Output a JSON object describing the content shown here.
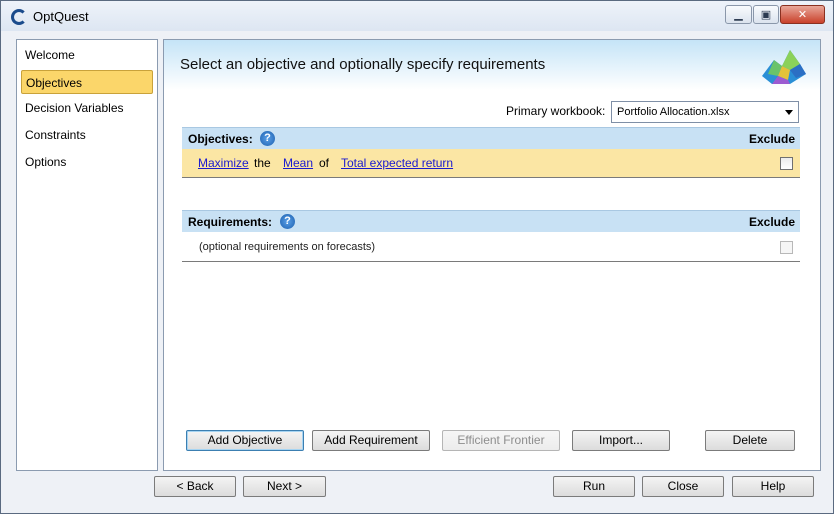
{
  "window": {
    "title": "OptQuest",
    "min_icon": "minimize-icon",
    "max_icon": "maximize-icon",
    "close_icon": "close-icon"
  },
  "nav": {
    "items": [
      "Welcome",
      "Objectives",
      "Decision Variables",
      "Constraints",
      "Options"
    ],
    "selected": "Objectives"
  },
  "main": {
    "header_title": "Select an objective and optionally specify requirements",
    "workbook_label": "Primary workbook:",
    "workbook_value": "Portfolio Allocation.xlsx",
    "objectives": {
      "heading": "Objectives:",
      "exclude_label": "Exclude",
      "row": {
        "goal": "Maximize",
        "the": "the",
        "stat": "Mean",
        "of": "of",
        "forecast": "Total expected return",
        "excluded": false
      }
    },
    "requirements": {
      "heading": "Requirements:",
      "exclude_label": "Exclude",
      "placeholder": "(optional requirements on forecasts)"
    },
    "buttons": {
      "add_objective": "Add Objective",
      "add_requirement": "Add Requirement",
      "efficient_frontier": "Efficient Frontier",
      "import": "Import...",
      "delete": "Delete"
    }
  },
  "footer": {
    "back": "< Back",
    "next": "Next >",
    "run": "Run",
    "close": "Close",
    "help": "Help"
  },
  "colors": {
    "selected_nav": "#fbd66a",
    "objective_row": "#fbe6a4",
    "section_header": "#c8e1f4",
    "link": "#1a1ad0"
  }
}
